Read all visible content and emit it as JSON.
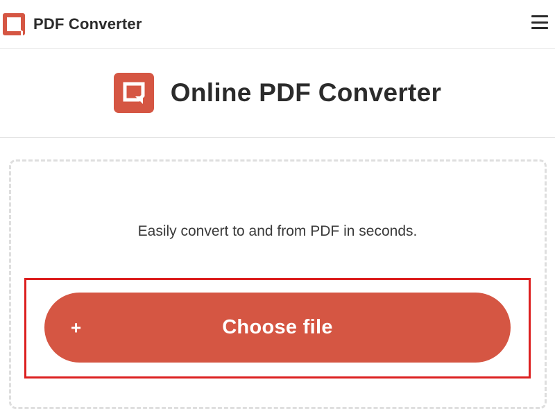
{
  "header": {
    "brand_name": "PDF Converter",
    "logo_icon": "pdf-converter-logo-icon",
    "menu_icon": "hamburger-menu-icon"
  },
  "hero": {
    "title": "Online PDF Converter"
  },
  "dropzone": {
    "tagline": "Easily convert to and from PDF in seconds.",
    "button_label": "Choose file",
    "button_icon": "+"
  },
  "colors": {
    "brand": "#d55643",
    "highlight": "#dc1f1f",
    "text": "#2b2b2b"
  }
}
